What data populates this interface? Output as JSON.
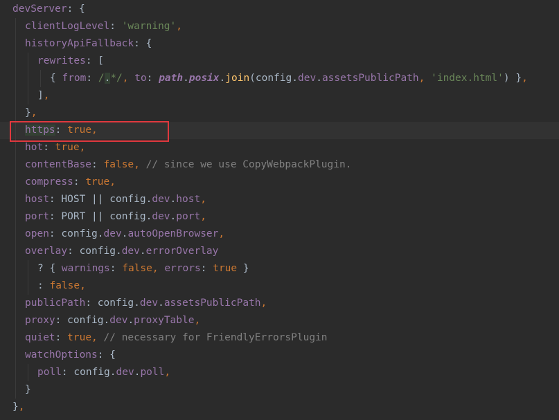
{
  "highlighted_line": 7,
  "colors": {
    "background": "#2b2b2b",
    "current_line": "#323232",
    "plain": "#a9b7c6",
    "property": "#9876aa",
    "string": "#6a8759",
    "keyword": "#cc7832",
    "comment": "#808080",
    "function": "#ffc66d",
    "highlight_box": "#e0383e"
  },
  "lines": [
    {
      "indent": 0,
      "tokens": [
        {
          "t": "devServer",
          "c": "property"
        },
        {
          "t": ": {",
          "c": "plain"
        }
      ]
    },
    {
      "indent": 1,
      "tokens": [
        {
          "t": "clientLogLevel",
          "c": "property"
        },
        {
          "t": ": ",
          "c": "plain"
        },
        {
          "t": "'warning'",
          "c": "string"
        },
        {
          "t": ",",
          "c": "keyword"
        }
      ]
    },
    {
      "indent": 1,
      "tokens": [
        {
          "t": "historyApiFallback",
          "c": "property"
        },
        {
          "t": ": {",
          "c": "plain"
        }
      ]
    },
    {
      "indent": 2,
      "tokens": [
        {
          "t": "rewrites",
          "c": "property"
        },
        {
          "t": ": [",
          "c": "plain"
        }
      ]
    },
    {
      "indent": 3,
      "tokens": [
        {
          "t": "{ ",
          "c": "plain"
        },
        {
          "t": "from",
          "c": "property"
        },
        {
          "t": ": ",
          "c": "plain"
        },
        {
          "t": "/",
          "c": "string"
        },
        {
          "t": ".",
          "c": "plain",
          "bg": "#344134"
        },
        {
          "t": "*/",
          "c": "string"
        },
        {
          "t": ", ",
          "c": "keyword"
        },
        {
          "t": "to",
          "c": "property"
        },
        {
          "t": ": ",
          "c": "plain"
        },
        {
          "t": "path",
          "c": "property",
          "bold": true,
          "italic": true
        },
        {
          "t": ".",
          "c": "plain"
        },
        {
          "t": "posix",
          "c": "property",
          "bold": true,
          "italic": true
        },
        {
          "t": ".",
          "c": "plain"
        },
        {
          "t": "join",
          "c": "function"
        },
        {
          "t": "(config.",
          "c": "plain"
        },
        {
          "t": "dev",
          "c": "property"
        },
        {
          "t": ".",
          "c": "plain"
        },
        {
          "t": "assetsPublicPath",
          "c": "property"
        },
        {
          "t": ", ",
          "c": "keyword"
        },
        {
          "t": "'index.html'",
          "c": "string"
        },
        {
          "t": ") }",
          "c": "plain"
        },
        {
          "t": ",",
          "c": "keyword"
        }
      ]
    },
    {
      "indent": 2,
      "tokens": [
        {
          "t": "]",
          "c": "plain"
        },
        {
          "t": ",",
          "c": "keyword"
        }
      ]
    },
    {
      "indent": 1,
      "tokens": [
        {
          "t": "}",
          "c": "plain"
        },
        {
          "t": ",",
          "c": "keyword"
        }
      ]
    },
    {
      "indent": 1,
      "tokens": [
        {
          "t": "https",
          "c": "property",
          "bg": "#344134"
        },
        {
          "t": ": ",
          "c": "plain"
        },
        {
          "t": "true",
          "c": "keyword"
        },
        {
          "t": ",",
          "c": "keyword"
        }
      ]
    },
    {
      "indent": 1,
      "tokens": [
        {
          "t": "hot",
          "c": "property"
        },
        {
          "t": ": ",
          "c": "plain"
        },
        {
          "t": "true",
          "c": "keyword"
        },
        {
          "t": ",",
          "c": "keyword"
        }
      ]
    },
    {
      "indent": 1,
      "tokens": [
        {
          "t": "contentBase",
          "c": "property"
        },
        {
          "t": ": ",
          "c": "plain"
        },
        {
          "t": "false",
          "c": "keyword"
        },
        {
          "t": ", ",
          "c": "keyword"
        },
        {
          "t": "// since we use CopyWebpackPlugin.",
          "c": "comment"
        }
      ]
    },
    {
      "indent": 1,
      "tokens": [
        {
          "t": "compress",
          "c": "property"
        },
        {
          "t": ": ",
          "c": "plain"
        },
        {
          "t": "true",
          "c": "keyword"
        },
        {
          "t": ",",
          "c": "keyword"
        }
      ]
    },
    {
      "indent": 1,
      "tokens": [
        {
          "t": "host",
          "c": "property"
        },
        {
          "t": ": HOST ",
          "c": "plain"
        },
        {
          "t": "||",
          "c": "plain"
        },
        {
          "t": " config.",
          "c": "plain"
        },
        {
          "t": "dev",
          "c": "property"
        },
        {
          "t": ".",
          "c": "plain"
        },
        {
          "t": "host",
          "c": "property"
        },
        {
          "t": ",",
          "c": "keyword"
        }
      ]
    },
    {
      "indent": 1,
      "tokens": [
        {
          "t": "port",
          "c": "property"
        },
        {
          "t": ": PORT ",
          "c": "plain"
        },
        {
          "t": "||",
          "c": "plain"
        },
        {
          "t": " config.",
          "c": "plain"
        },
        {
          "t": "dev",
          "c": "property"
        },
        {
          "t": ".",
          "c": "plain"
        },
        {
          "t": "port",
          "c": "property"
        },
        {
          "t": ",",
          "c": "keyword"
        }
      ]
    },
    {
      "indent": 1,
      "tokens": [
        {
          "t": "open",
          "c": "property"
        },
        {
          "t": ": config.",
          "c": "plain"
        },
        {
          "t": "dev",
          "c": "property"
        },
        {
          "t": ".",
          "c": "plain"
        },
        {
          "t": "autoOpenBrowser",
          "c": "property"
        },
        {
          "t": ",",
          "c": "keyword"
        }
      ]
    },
    {
      "indent": 1,
      "tokens": [
        {
          "t": "overlay",
          "c": "property"
        },
        {
          "t": ": config.",
          "c": "plain"
        },
        {
          "t": "dev",
          "c": "property"
        },
        {
          "t": ".",
          "c": "plain"
        },
        {
          "t": "errorOverlay",
          "c": "property"
        }
      ]
    },
    {
      "indent": 2,
      "tokens": [
        {
          "t": "? { ",
          "c": "plain"
        },
        {
          "t": "warnings",
          "c": "property"
        },
        {
          "t": ": ",
          "c": "plain"
        },
        {
          "t": "false",
          "c": "keyword"
        },
        {
          "t": ", ",
          "c": "keyword"
        },
        {
          "t": "errors",
          "c": "property"
        },
        {
          "t": ": ",
          "c": "plain"
        },
        {
          "t": "true",
          "c": "keyword"
        },
        {
          "t": " }",
          "c": "plain"
        }
      ]
    },
    {
      "indent": 2,
      "tokens": [
        {
          "t": ": ",
          "c": "plain"
        },
        {
          "t": "false",
          "c": "keyword"
        },
        {
          "t": ",",
          "c": "keyword"
        }
      ]
    },
    {
      "indent": 1,
      "tokens": [
        {
          "t": "publicPath",
          "c": "property"
        },
        {
          "t": ": config.",
          "c": "plain"
        },
        {
          "t": "dev",
          "c": "property"
        },
        {
          "t": ".",
          "c": "plain"
        },
        {
          "t": "assetsPublicPath",
          "c": "property"
        },
        {
          "t": ",",
          "c": "keyword"
        }
      ]
    },
    {
      "indent": 1,
      "tokens": [
        {
          "t": "proxy",
          "c": "property"
        },
        {
          "t": ": config.",
          "c": "plain"
        },
        {
          "t": "dev",
          "c": "property"
        },
        {
          "t": ".",
          "c": "plain"
        },
        {
          "t": "proxyTable",
          "c": "property"
        },
        {
          "t": ",",
          "c": "keyword"
        }
      ]
    },
    {
      "indent": 1,
      "tokens": [
        {
          "t": "quiet",
          "c": "property"
        },
        {
          "t": ": ",
          "c": "plain"
        },
        {
          "t": "true",
          "c": "keyword"
        },
        {
          "t": ", ",
          "c": "keyword"
        },
        {
          "t": "// necessary for FriendlyErrorsPlugin",
          "c": "comment"
        }
      ]
    },
    {
      "indent": 1,
      "tokens": [
        {
          "t": "watchOptions",
          "c": "property"
        },
        {
          "t": ": {",
          "c": "plain"
        }
      ]
    },
    {
      "indent": 2,
      "tokens": [
        {
          "t": "poll",
          "c": "property"
        },
        {
          "t": ": config.",
          "c": "plain"
        },
        {
          "t": "dev",
          "c": "property"
        },
        {
          "t": ".",
          "c": "plain"
        },
        {
          "t": "poll",
          "c": "property"
        },
        {
          "t": ",",
          "c": "keyword"
        }
      ]
    },
    {
      "indent": 1,
      "tokens": [
        {
          "t": "}",
          "c": "plain"
        }
      ]
    },
    {
      "indent": 0,
      "tokens": [
        {
          "t": "}",
          "c": "plain"
        },
        {
          "t": ",",
          "c": "keyword"
        }
      ]
    }
  ]
}
